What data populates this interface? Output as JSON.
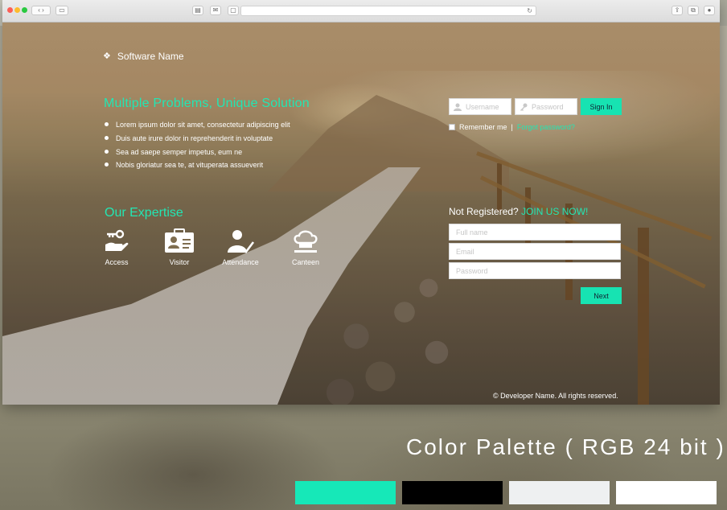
{
  "app": {
    "brand_name": "Software Name",
    "brand_icon": "diamond-cluster-icon"
  },
  "hero": {
    "headline": "Multiple Problems, Unique Solution",
    "bullets": [
      "Lorem ipsum dolor sit amet, consectetur adipiscing elit",
      "Duis aute irure dolor in reprehenderit in voluptate",
      "Sea ad saepe semper impetus, eum ne",
      "Nobis gloriatur sea te, at vituperata assueverit"
    ]
  },
  "expertise": {
    "title": "Our Expertise",
    "items": [
      {
        "label": "Access",
        "icon": "hand-key-icon"
      },
      {
        "label": "Visitor",
        "icon": "id-badge-icon"
      },
      {
        "label": "Attendance",
        "icon": "person-check-icon"
      },
      {
        "label": "Canteen",
        "icon": "chef-hat-icon"
      }
    ]
  },
  "login": {
    "username_placeholder": "Username",
    "password_placeholder": "Password",
    "signin_label": "Sign In",
    "remember_label": "Remember me",
    "separator": "|",
    "forgot_label": "Forgot password?"
  },
  "register": {
    "prompt": "Not Registered?",
    "join_label": "JOIN US NOW!",
    "fullname_placeholder": "Full name",
    "email_placeholder": "Email",
    "password_placeholder": "Password",
    "next_label": "Next"
  },
  "footer": {
    "copyright": "© Developer Name. All rights reserved."
  },
  "palette": {
    "title": "Color Palette ( RGB 24 bit )",
    "colors": [
      "#16e8b8",
      "#000000",
      "#eef0f1",
      "#ffffff"
    ]
  },
  "theme": {
    "accent": "#17e3b2"
  }
}
